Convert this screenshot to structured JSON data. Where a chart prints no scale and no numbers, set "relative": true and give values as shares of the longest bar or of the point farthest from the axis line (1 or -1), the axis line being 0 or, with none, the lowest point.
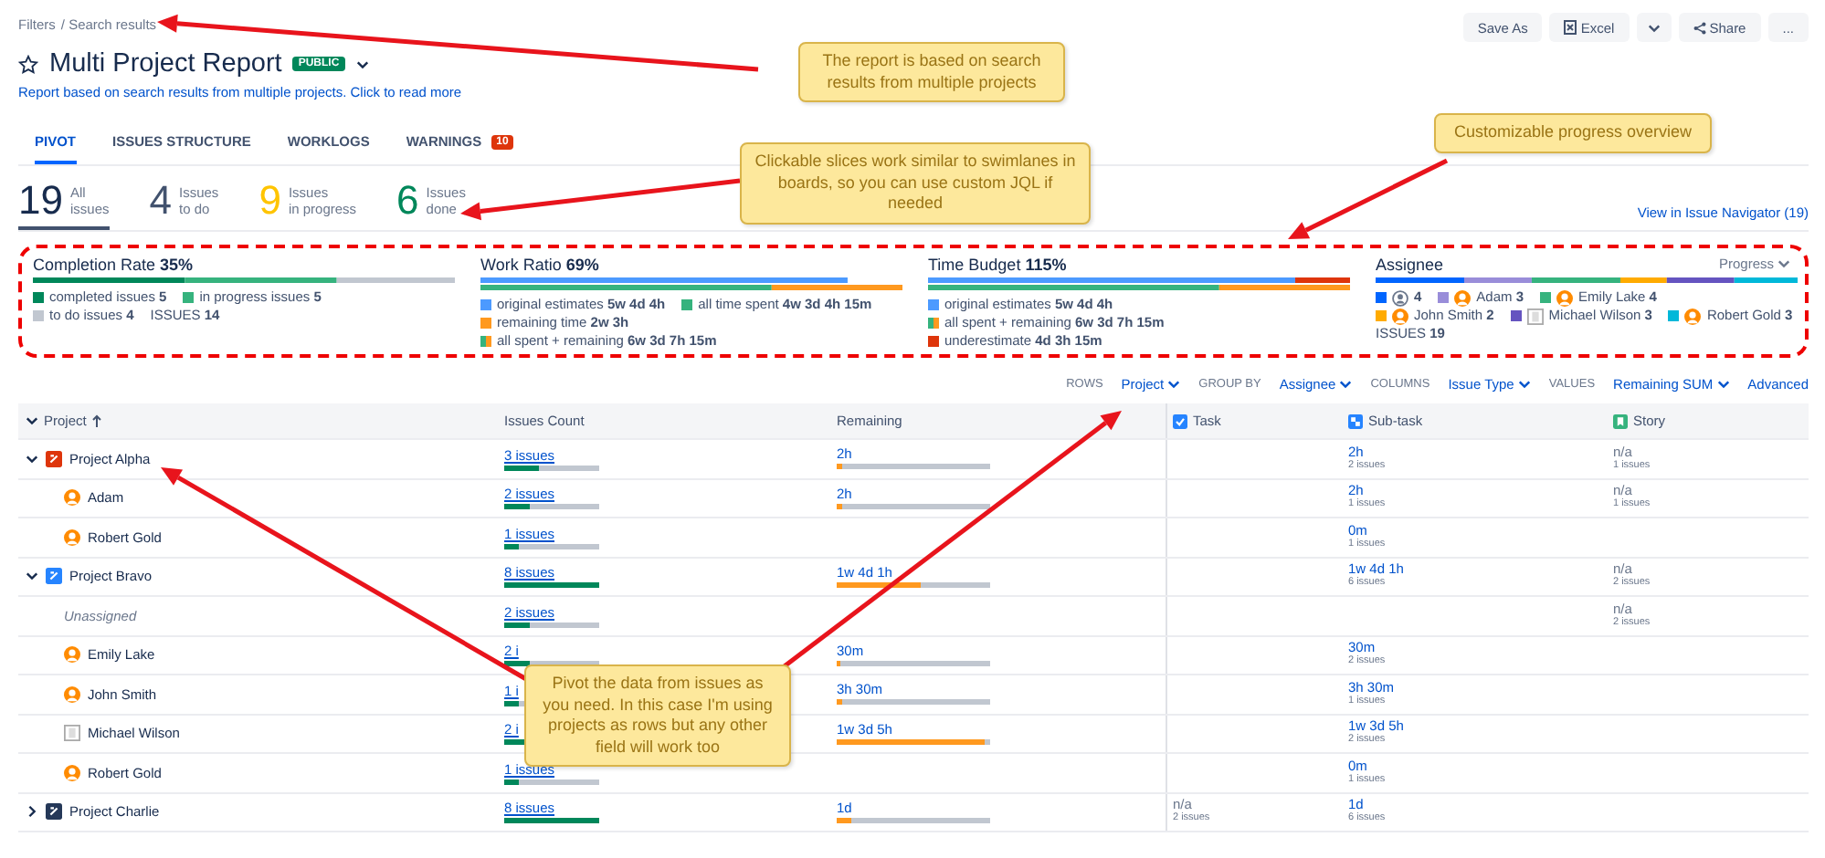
{
  "breadcrumb": [
    "Filters",
    "/ Search results"
  ],
  "title": "Multi Project Report",
  "badge": "PUBLIC",
  "subtitle": "Report based on search results from multiple projects. Click to read more",
  "actions": {
    "save": "Save As",
    "excel": "Excel",
    "share": "Share",
    "more": "..."
  },
  "tabs": [
    {
      "label": "PIVOT",
      "selected": true
    },
    {
      "label": "ISSUES STRUCTURE",
      "selected": false
    },
    {
      "label": "WORKLOGS",
      "selected": false
    },
    {
      "label": "WARNINGS",
      "selected": false,
      "badge": "10"
    }
  ],
  "stats": [
    {
      "number": "19",
      "label": [
        "All",
        "issues"
      ],
      "color": "#172b4d",
      "selected": true
    },
    {
      "number": "4",
      "label": [
        "Issues",
        "to do"
      ],
      "color": "#42526e",
      "selected": false
    },
    {
      "number": "9",
      "label": [
        "Issues",
        "in progress"
      ],
      "color": "#ffc400",
      "selected": false
    },
    {
      "number": "6",
      "label": [
        "Issues",
        "done"
      ],
      "color": "#00875a",
      "selected": false
    }
  ],
  "navigator_link": "View in Issue Navigator (19)",
  "summary": [
    {
      "title": "Completion Rate",
      "value": "35%",
      "chart_data": {
        "type": "bar",
        "orientation": "horizontal",
        "stacked": true,
        "relative": true,
        "series": [
          {
            "color": "#00875a",
            "values": [
              0.36
            ]
          },
          {
            "color": "#36b37e",
            "values": [
              0.36
            ]
          },
          {
            "color": "#c1c7d0",
            "values": [
              0.28
            ]
          }
        ]
      },
      "lines": [
        [
          {
            "kind": "swatch",
            "color": "#00875a",
            "label": "completed issues",
            "value": "5"
          },
          {
            "kind": "swatch",
            "color": "#36b37e",
            "label": "in progress issues",
            "value": "5"
          }
        ],
        [
          {
            "kind": "swatch",
            "color": "#c1c7d0",
            "label": "to do issues",
            "value": "4"
          },
          {
            "kind": "total",
            "label": "ISSUES",
            "value": "14"
          }
        ]
      ]
    },
    {
      "title": "Work Ratio",
      "value": "69%",
      "chart_data": {
        "type": "bar",
        "orientation": "horizontal",
        "stacked": true,
        "relative": true,
        "series": [
          {
            "color": "#4c9aff",
            "values": [
              0.87,
              null
            ]
          },
          {
            "color": "#36b37e",
            "values": [
              null,
              0.69
            ]
          },
          {
            "color": "#ff991f",
            "values": [
              null,
              0.31
            ]
          }
        ]
      },
      "lines": [
        [
          {
            "kind": "swatch",
            "color": "#4c9aff",
            "label": "original estimates",
            "value": "5w 4d 4h"
          },
          {
            "kind": "swatch",
            "color": "#36b37e",
            "label": "all time spent",
            "value": "4w 3d 4h 15m"
          }
        ],
        [
          {
            "kind": "swatch",
            "color": "#ff991f",
            "label": "remaining time",
            "value": "2w 3h"
          }
        ],
        [
          {
            "kind": "split",
            "color": "#36b37e",
            "label": "all spent + remaining",
            "value": "6w 3d 7h 15m"
          }
        ]
      ]
    },
    {
      "title": "Time Budget",
      "value": "115%",
      "chart_data": {
        "type": "bar",
        "orientation": "horizontal",
        "stacked": true,
        "relative": true,
        "series": [
          {
            "color": "#4c9aff",
            "values": [
              0.87,
              null
            ]
          },
          {
            "color": "#de350b",
            "values": [
              0.13,
              null
            ]
          },
          {
            "color": "#36b37e",
            "values": [
              null,
              0.69
            ]
          },
          {
            "color": "#ff991f",
            "values": [
              null,
              0.31
            ]
          }
        ]
      },
      "lines": [
        [
          {
            "kind": "swatch",
            "color": "#4c9aff",
            "label": "original estimates",
            "value": "5w 4d 4h"
          }
        ],
        [
          {
            "kind": "split",
            "color": "#36b37e",
            "label": "all spent + remaining",
            "value": "6w 3d 7h 15m"
          }
        ],
        [
          {
            "kind": "swatch",
            "color": "#de350b",
            "label": "underestimate",
            "value": "4d 3h 15m"
          }
        ]
      ]
    },
    {
      "title": "Assignee",
      "dropdown": "Progress",
      "chart_data": {
        "type": "bar",
        "orientation": "horizontal",
        "stacked": true,
        "relative": true,
        "series": [
          {
            "color": "#0065ff",
            "values": [
              0.21
            ]
          },
          {
            "color": "#998dd9",
            "values": [
              0.16
            ]
          },
          {
            "color": "#36b37e",
            "values": [
              0.21
            ]
          },
          {
            "color": "#ffab00",
            "values": [
              0.11
            ]
          },
          {
            "color": "#6554c0",
            "values": [
              0.16
            ]
          },
          {
            "color": "#00b8d9",
            "values": [
              0.15
            ]
          }
        ]
      },
      "lines": [
        [
          {
            "kind": "unknown",
            "color": "#0065ff",
            "value": "4"
          },
          {
            "kind": "person",
            "color": "#998dd9",
            "label": "Adam",
            "value": "3"
          },
          {
            "kind": "person",
            "color": "#36b37e",
            "label": "Emily Lake",
            "value": "4"
          }
        ],
        [
          {
            "kind": "person",
            "color": "#ffab00",
            "label": "John Smith",
            "value": "2"
          },
          {
            "kind": "placeholder",
            "color": "#6554c0",
            "label": "Michael Wilson",
            "value": "3"
          },
          {
            "kind": "person",
            "color": "#00b8d9",
            "label": "Robert Gold",
            "value": "3"
          }
        ],
        [
          {
            "kind": "total",
            "label": "ISSUES",
            "value": "19"
          }
        ]
      ]
    }
  ],
  "controls": [
    {
      "label": "ROWS",
      "value": "Project"
    },
    {
      "label": "GROUP BY",
      "value": "Assignee"
    },
    {
      "label": "COLUMNS",
      "value": "Issue Type"
    },
    {
      "label": "VALUES",
      "value": "Remaining SUM"
    }
  ],
  "advanced": "Advanced",
  "table": {
    "columns": [
      {
        "label": "Project",
        "kind": "sorted"
      },
      {
        "label": "Issues Count",
        "kind": "plain"
      },
      {
        "label": "Remaining",
        "kind": "plain"
      },
      {
        "label": "Task",
        "kind": "task"
      },
      {
        "label": "Sub-task",
        "kind": "subtask"
      },
      {
        "label": "Story",
        "kind": "story"
      }
    ],
    "rows": [
      {
        "name": "Project Alpha",
        "expanded": true,
        "issues": {
          "text": "3 issues",
          "level": 0.37
        },
        "remaining": {
          "text": "2h",
          "level": 0.03
        },
        "subtask": {
          "value": "2h",
          "sub": "2 issues"
        },
        "story": {
          "value": "n/a",
          "sub": "1 issues"
        },
        "children": [
          {
            "name": "Adam",
            "kind": "person",
            "issues": {
              "text": "2 issues",
              "level": 0.27
            },
            "remaining": {
              "text": "2h",
              "level": 0.03
            },
            "subtask": {
              "value": "2h",
              "sub": "1 issues"
            },
            "story": {
              "value": "n/a",
              "sub": "1 issues"
            }
          },
          {
            "name": "Robert Gold",
            "kind": "person",
            "issues": {
              "text": "1 issues",
              "level": 0.15
            },
            "subtask": {
              "value": "0m",
              "sub": "1 issues"
            }
          }
        ]
      },
      {
        "name": "Project Bravo",
        "expanded": true,
        "issues": {
          "text": "8 issues",
          "level": 1
        },
        "remaining": {
          "text": "1w 4d 1h",
          "level": 0.55
        },
        "subtask": {
          "value": "1w 4d 1h",
          "sub": "6 issues"
        },
        "story": {
          "value": "n/a",
          "sub": "2 issues"
        },
        "children": [
          {
            "name": "Unassigned",
            "kind": "unassigned",
            "issues": {
              "text": "2 issues",
              "level": 0.27
            },
            "story": {
              "value": "n/a",
              "sub": "2 issues"
            }
          },
          {
            "name": "Emily Lake",
            "kind": "person",
            "issues": {
              "text": "2 i",
              "level": 0.27
            },
            "remaining": {
              "text": "30m",
              "level": 0.02
            },
            "subtask": {
              "value": "30m",
              "sub": "2 issues"
            }
          },
          {
            "name": "John Smith",
            "kind": "person",
            "issues": {
              "text": "1 i",
              "level": 0.15
            },
            "remaining": {
              "text": "3h 30m",
              "level": 0.03
            },
            "subtask": {
              "value": "3h 30m",
              "sub": "1 issues"
            }
          },
          {
            "name": "Michael Wilson",
            "kind": "placeholder",
            "issues": {
              "text": "2 i",
              "level": 0.27
            },
            "remaining": {
              "text": "1w 3d 5h",
              "level": 0.96
            },
            "subtask": {
              "value": "1w 3d 5h",
              "sub": "2 issues"
            }
          },
          {
            "name": "Robert Gold",
            "kind": "person",
            "issues": {
              "text": "1 issues",
              "level": 0.15
            },
            "subtask": {
              "value": "0m",
              "sub": "1 issues"
            }
          }
        ]
      },
      {
        "name": "Project Charlie",
        "expanded": false,
        "issues": {
          "text": "8 issues",
          "level": 1
        },
        "remaining": {
          "text": "1d",
          "level": 0.1
        },
        "task": {
          "value": "n/a",
          "sub": "2 issues"
        },
        "subtask": {
          "value": "1d",
          "sub": "6 issues"
        }
      }
    ]
  },
  "annotations": [
    {
      "text": "The report is based on search results from multiple projects"
    },
    {
      "text": "Clickable slices work similar to swimlanes in boards, so you can use custom JQL if needed"
    },
    {
      "text": "Customizable progress overview"
    },
    {
      "text": "Pivot the data from issues as you need. In this case I'm using projects as rows but any other field will work too"
    }
  ]
}
